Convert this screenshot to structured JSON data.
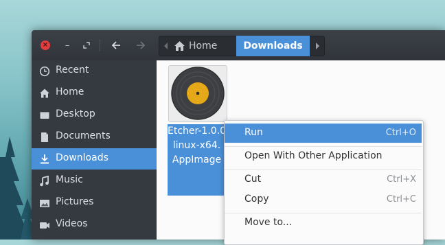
{
  "window": {
    "close_glyph": "×",
    "minimize_glyph": "–"
  },
  "pathbar": {
    "home_label": "Home",
    "current_label": "Downloads"
  },
  "sidebar": {
    "items": [
      {
        "label": "Recent",
        "icon": "clock-icon"
      },
      {
        "label": "Home",
        "icon": "home-icon"
      },
      {
        "label": "Desktop",
        "icon": "desktop-icon"
      },
      {
        "label": "Documents",
        "icon": "document-icon"
      },
      {
        "label": "Downloads",
        "icon": "download-icon",
        "active": true
      },
      {
        "label": "Music",
        "icon": "music-icon"
      },
      {
        "label": "Pictures",
        "icon": "picture-icon"
      },
      {
        "label": "Videos",
        "icon": "video-icon"
      }
    ]
  },
  "file": {
    "name_lines": [
      "Etcher-1.0.0-",
      "linux-x64.",
      "AppImage"
    ],
    "icon": "vinyl-disc-icon",
    "disc_color": "#e4a818"
  },
  "context_menu": {
    "items": [
      {
        "label": "Run",
        "accel": "Ctrl+O",
        "active": true
      },
      {
        "label": "Open With Other Application",
        "accel": ""
      },
      {
        "label": "Cut",
        "accel": "Ctrl+X"
      },
      {
        "label": "Copy",
        "accel": "Ctrl+C"
      },
      {
        "label": "Move to...",
        "accel": ""
      }
    ]
  },
  "colors": {
    "accent": "#4a90d9",
    "sidebar_bg": "#353a41",
    "headerbar_bg": "#363a40",
    "close_button": "#e23d3d"
  }
}
